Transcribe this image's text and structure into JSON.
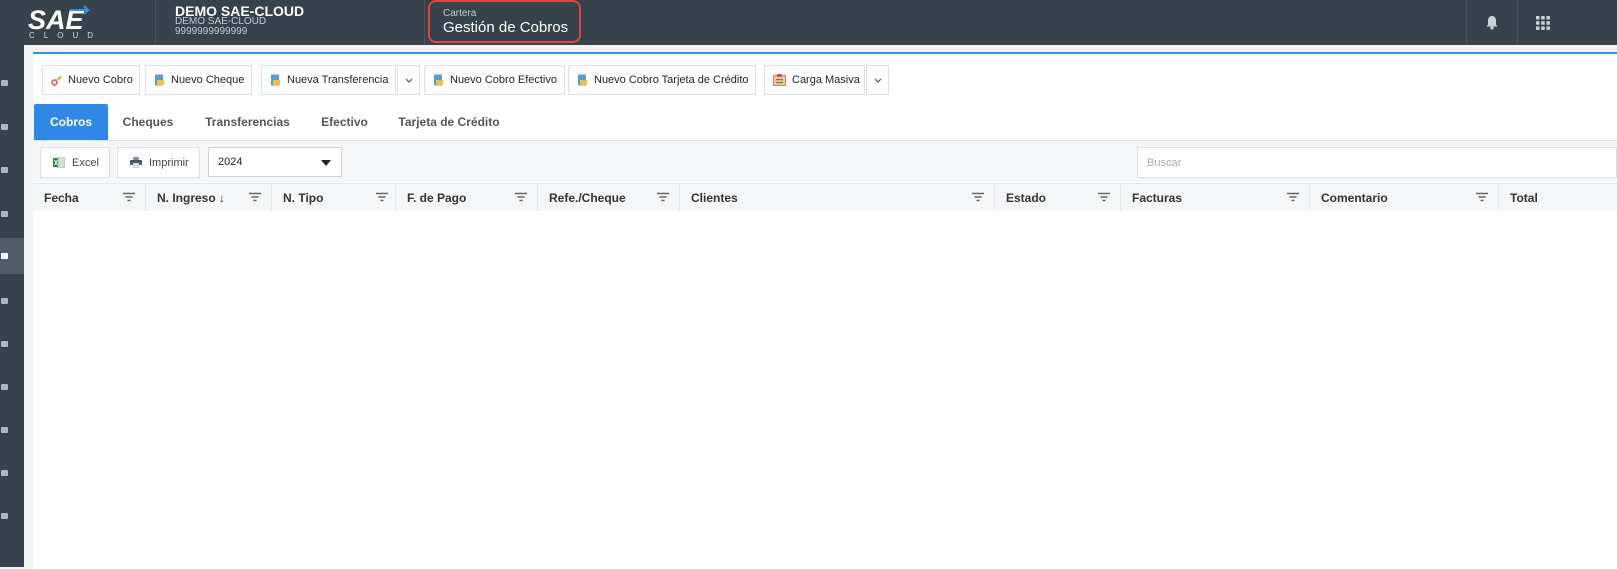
{
  "app": {
    "logo_text": "SAE",
    "logo_sub": "CLOUD",
    "company_name": "DEMO SAE-CLOUD",
    "company_sub": "DEMO SAE-CLOUD",
    "company_id": "9999999999999",
    "module": "Cartera",
    "title": "Gestión de Cobros",
    "accent": "#2e8ae6",
    "highlight": "#e0453a"
  },
  "toolbar": {
    "nuevo_cobro": "Nuevo Cobro",
    "nuevo_cheque": "Nuevo Cheque",
    "nueva_transferencia": "Nueva Transferencia",
    "nuevo_efectivo": "Nuevo Cobro Efectivo",
    "nuevo_tarjeta": "Nuevo Cobro Tarjeta de Crédito",
    "carga_masiva": "Carga Masiva"
  },
  "tabs": [
    "Cobros",
    "Cheques",
    "Transferencias",
    "Efectivo",
    "Tarjeta de Crédito"
  ],
  "active_tab": "Cobros",
  "grid_tools": {
    "excel": "Excel",
    "print": "Imprimir",
    "year": "2024",
    "search_placeholder": "Buscar"
  },
  "columns": [
    "Fecha",
    "N. Ingreso ↓",
    "N. Tipo",
    "F. de Pago",
    "Refe./Cheque",
    "Clientes",
    "Estado",
    "Facturas",
    "Comentario",
    "Total"
  ],
  "icons": {
    "notifications": "bell-icon",
    "apps": "grid-icon"
  }
}
